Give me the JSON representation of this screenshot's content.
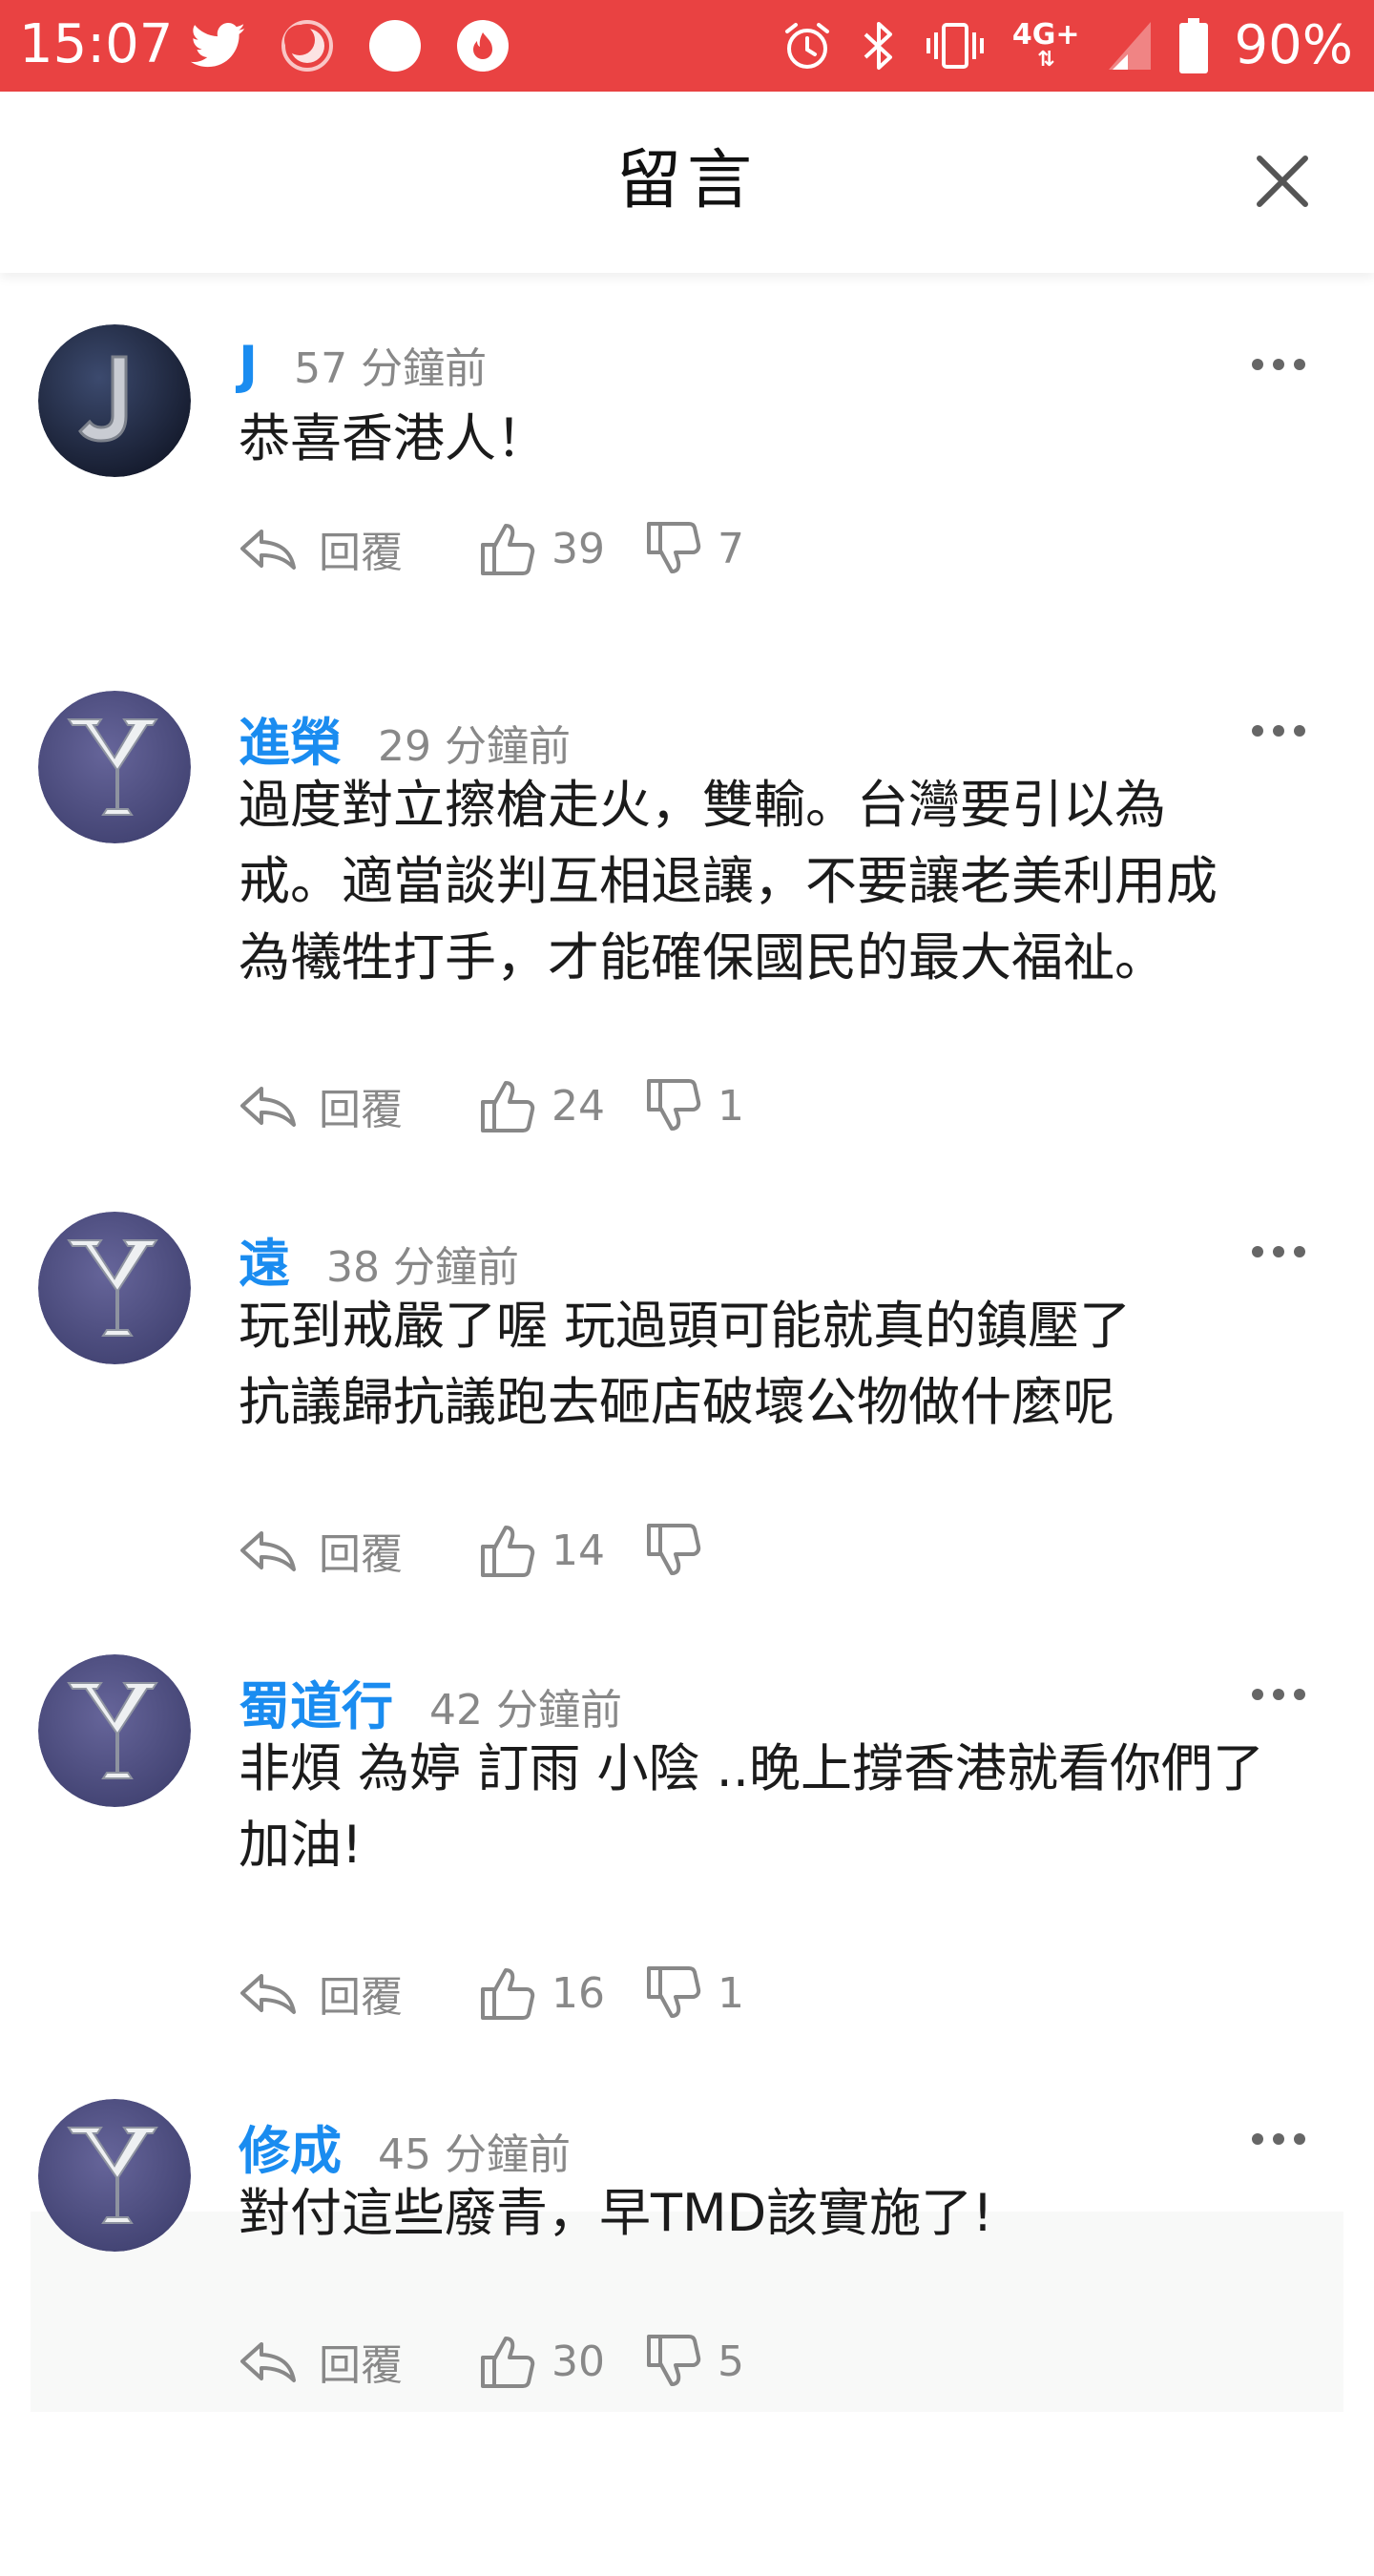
{
  "status_bar": {
    "time": "15:07",
    "left_icons": [
      "twitter-icon",
      "moon-icon",
      "circle-icon",
      "flame-icon"
    ],
    "right_icons": [
      "alarm-icon",
      "bluetooth-icon",
      "vibrate-icon",
      "lte-icon",
      "signal-icon",
      "battery-icon"
    ],
    "network": "4G+",
    "battery": "90%",
    "background": "#e94242"
  },
  "header": {
    "title": "留言",
    "close_icon": "close-icon"
  },
  "actions_label": {
    "reply": "回覆"
  },
  "colors": {
    "username": "#1a8cf0",
    "muted": "#888888"
  },
  "comments": [
    {
      "avatar": "J",
      "user": "J",
      "time": "57 分鐘前",
      "text": "恭喜香港人！",
      "likes": "39",
      "dislikes": "7"
    },
    {
      "avatar": "Y",
      "user": "進榮",
      "time": "29 分鐘前",
      "text": "過度對立擦槍走火，雙輸。台灣要引以為\n戒。適當談判互相退讓，不要讓老美利用成\n為犧牲打手，才能確保國民的最大福祉。",
      "likes": "24",
      "dislikes": "1"
    },
    {
      "avatar": "Y",
      "user": "遠",
      "time": "38 分鐘前",
      "text": "玩到戒嚴了喔 玩過頭可能就真的鎮壓了\n抗議歸抗議跑去砸店破壞公物做什麼呢",
      "likes": "14",
      "dislikes": ""
    },
    {
      "avatar": "Y",
      "user": "蜀道行",
      "time": "42 分鐘前",
      "text": "非煩 為婷 訂雨 小陰 ..晚上撐香港就看你們了\n加油!",
      "likes": "16",
      "dislikes": "1"
    },
    {
      "avatar": "Y",
      "user": "修成",
      "time": "45 分鐘前",
      "text": "對付這些廢青，早TMD該實施了!",
      "likes": "30",
      "dislikes": "5"
    }
  ]
}
